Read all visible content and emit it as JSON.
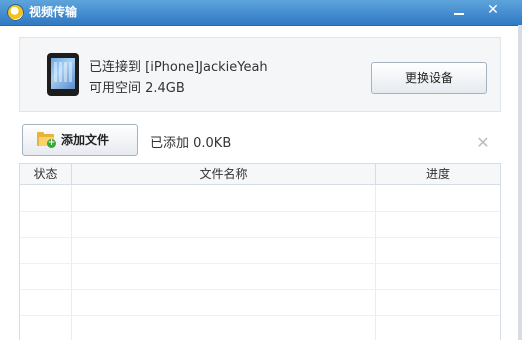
{
  "window": {
    "title": "视频传输",
    "minimize_label": "",
    "close_label": "✕"
  },
  "device": {
    "connected_text": "已连接到 [iPhone]JackieYeah",
    "space_text": "可用空间 2.4GB",
    "change_button": "更换设备"
  },
  "toolbar": {
    "add_file_button": "添加文件",
    "added_text": "已添加 0.0KB",
    "clear_icon": "✕"
  },
  "table": {
    "columns": [
      "状态",
      "文件名称",
      "进度"
    ],
    "rows": []
  },
  "colors": {
    "titlebar": "#3a86cc",
    "panel_bg": "#f5f6f8",
    "border": "#d7dde4"
  }
}
